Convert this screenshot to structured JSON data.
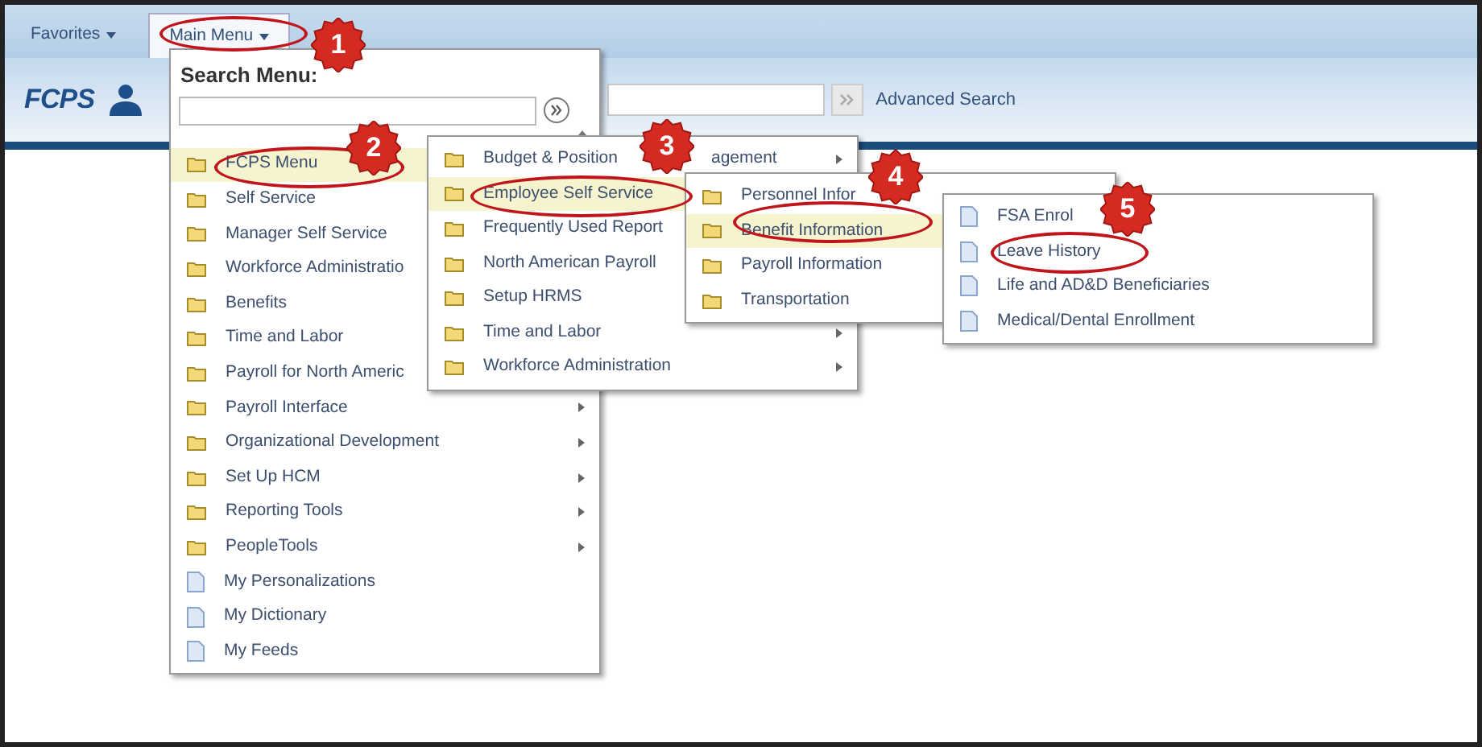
{
  "top_bar": {
    "tabs": [
      {
        "label": "Favorites",
        "selected": false
      },
      {
        "label": "Main Menu",
        "selected": true
      }
    ]
  },
  "header": {
    "logo_text": "FCPS",
    "advanced_search": "Advanced Search"
  },
  "menus": [
    {
      "title": "Search Menu:",
      "items": [
        {
          "label": "FCPS Menu",
          "kind": "folder",
          "selected": true,
          "submenu": false
        },
        {
          "label": "Self Service",
          "kind": "folder",
          "selected": false,
          "submenu": false
        },
        {
          "label": "Manager Self Service",
          "kind": "folder",
          "selected": false,
          "submenu": false
        },
        {
          "label": "Workforce Administratio",
          "kind": "folder",
          "selected": false,
          "submenu": false
        },
        {
          "label": "Benefits",
          "kind": "folder",
          "selected": false,
          "submenu": false
        },
        {
          "label": "Time and Labor",
          "kind": "folder",
          "selected": false,
          "submenu": false
        },
        {
          "label": "Payroll for North Americ",
          "kind": "folder",
          "selected": false,
          "submenu": false
        },
        {
          "label": "Payroll Interface",
          "kind": "folder",
          "selected": false,
          "submenu": true
        },
        {
          "label": "Organizational Development",
          "kind": "folder",
          "selected": false,
          "submenu": true
        },
        {
          "label": "Set Up HCM",
          "kind": "folder",
          "selected": false,
          "submenu": true
        },
        {
          "label": "Reporting Tools",
          "kind": "folder",
          "selected": false,
          "submenu": true
        },
        {
          "label": "PeopleTools",
          "kind": "folder",
          "selected": false,
          "submenu": true
        },
        {
          "label": "My Personalizations",
          "kind": "page",
          "selected": false,
          "submenu": false
        },
        {
          "label": "My Dictionary",
          "kind": "page",
          "selected": false,
          "submenu": false
        },
        {
          "label": "My Feeds",
          "kind": "page",
          "selected": false,
          "submenu": false
        }
      ]
    },
    {
      "items": [
        {
          "label": "Budget & Position",
          "tail": "agement",
          "kind": "folder",
          "selected": false,
          "submenu": true
        },
        {
          "label": "Employee Self Service",
          "kind": "folder",
          "selected": true,
          "submenu": false
        },
        {
          "label": "Frequently Used Report",
          "kind": "folder",
          "selected": false,
          "submenu": false
        },
        {
          "label": "North American Payroll",
          "kind": "folder",
          "selected": false,
          "submenu": false
        },
        {
          "label": "Setup HRMS",
          "kind": "folder",
          "selected": false,
          "submenu": false
        },
        {
          "label": "Time and Labor",
          "kind": "folder",
          "selected": false,
          "submenu": true
        },
        {
          "label": "Workforce Administration",
          "kind": "folder",
          "selected": false,
          "submenu": true
        }
      ]
    },
    {
      "items": [
        {
          "label": "Personnel Infor",
          "kind": "folder",
          "selected": false,
          "submenu": false
        },
        {
          "label": "Benefit Information",
          "kind": "folder",
          "selected": true,
          "submenu": false
        },
        {
          "label": "Payroll Information",
          "kind": "folder",
          "selected": false,
          "submenu": false
        },
        {
          "label": "Transportation",
          "kind": "folder",
          "selected": false,
          "submenu": false
        }
      ]
    },
    {
      "items": [
        {
          "label": "FSA Enrol",
          "kind": "page",
          "selected": false,
          "submenu": false
        },
        {
          "label": "Leave History",
          "kind": "page",
          "selected": false,
          "submenu": false
        },
        {
          "label": "Life and AD&D Beneficiaries",
          "kind": "page",
          "selected": false,
          "submenu": false
        },
        {
          "label": "Medical/Dental Enrollment",
          "kind": "page",
          "selected": false,
          "submenu": false
        }
      ]
    }
  ],
  "annotations": [
    {
      "number": "1"
    },
    {
      "number": "2"
    },
    {
      "number": "3"
    },
    {
      "number": "4"
    },
    {
      "number": "5"
    }
  ]
}
